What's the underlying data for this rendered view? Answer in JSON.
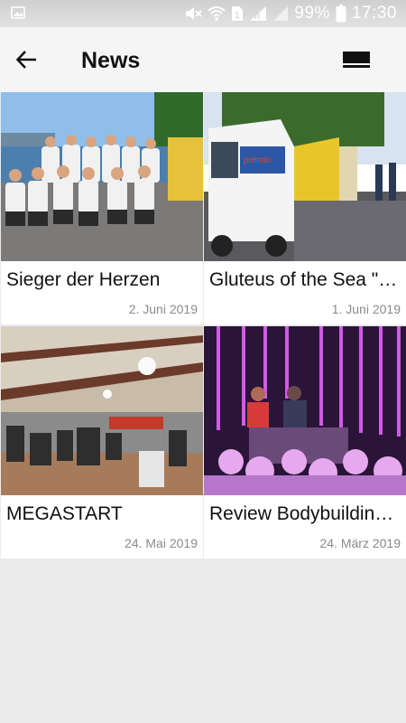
{
  "status_bar": {
    "battery_percent": "99%",
    "time": "17:30"
  },
  "app_bar": {
    "title": "News",
    "back_icon": "arrow-back-icon",
    "view_icon": "view-toggle-icon"
  },
  "news_items": [
    {
      "title": "Sieger der Herzen",
      "date": "2. Juni 2019"
    },
    {
      "title": "Gluteus of the Sea \"cle…",
      "date": "1. Juni 2019"
    },
    {
      "title": "MEGASTART",
      "date": "24. Mai 2019"
    },
    {
      "title": "Review Bodybuilding S…",
      "date": "24. März 2019"
    }
  ],
  "colors": {
    "app_bar_bg": "#f5f5f5",
    "page_bg": "#ebebeb",
    "date_text": "#8a8a8a"
  }
}
